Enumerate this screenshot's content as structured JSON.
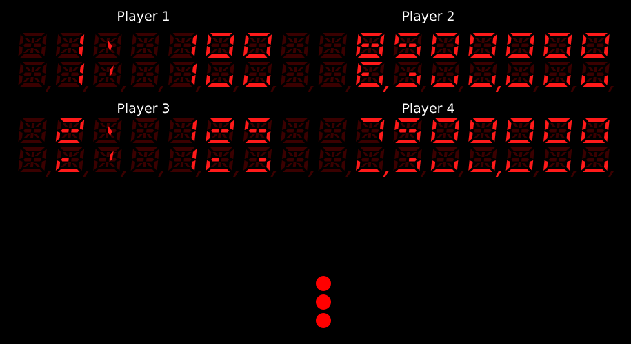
{
  "colors": {
    "lit": "#ff1a1a",
    "unlit": "#3a0000",
    "label": "#ffffff",
    "background": "#000000"
  },
  "players": [
    {
      "label": "Player 1",
      "display": "1:100",
      "score": "1,100"
    },
    {
      "label": "Player 2",
      "display": "8,500,000",
      "score": "8,500,000"
    },
    {
      "label": "Player 3",
      "display": "2:125",
      "score": "2,125"
    },
    {
      "label": "Player 4",
      "display": "7,500,000",
      "score": "7,500,000"
    }
  ],
  "balls_remaining": 3
}
